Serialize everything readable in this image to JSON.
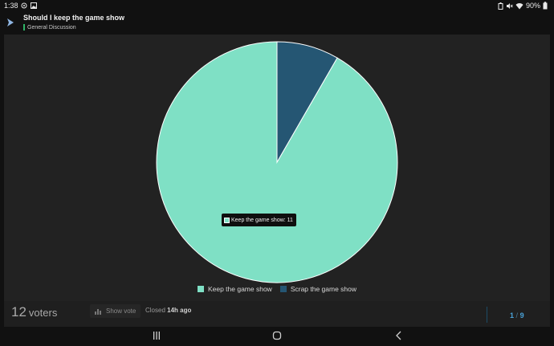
{
  "status_bar": {
    "time": "1:38",
    "battery": "90%",
    "icons": [
      "sync-icon",
      "image-icon",
      "battery-saver-icon",
      "mute-icon",
      "wifi-icon",
      "battery-icon"
    ]
  },
  "header": {
    "title": "Should I keep the game show",
    "category": "General Discussion",
    "category_color": "#2fb567"
  },
  "chart_data": {
    "type": "pie",
    "categories": [
      "Keep the game show",
      "Scrap the game show"
    ],
    "values": [
      11,
      1
    ],
    "colors": [
      "#7fe0c5",
      "#255673"
    ],
    "legend_position": "bottom-center",
    "tooltip": "Keep the game show: 11"
  },
  "footer": {
    "voters_count": "12",
    "voters_label": "voters",
    "show_vote_label": "Show vote",
    "closed_prefix": "Closed",
    "closed_time": "14h ago",
    "page_current": "1",
    "page_separator": "/",
    "page_total": "9"
  }
}
